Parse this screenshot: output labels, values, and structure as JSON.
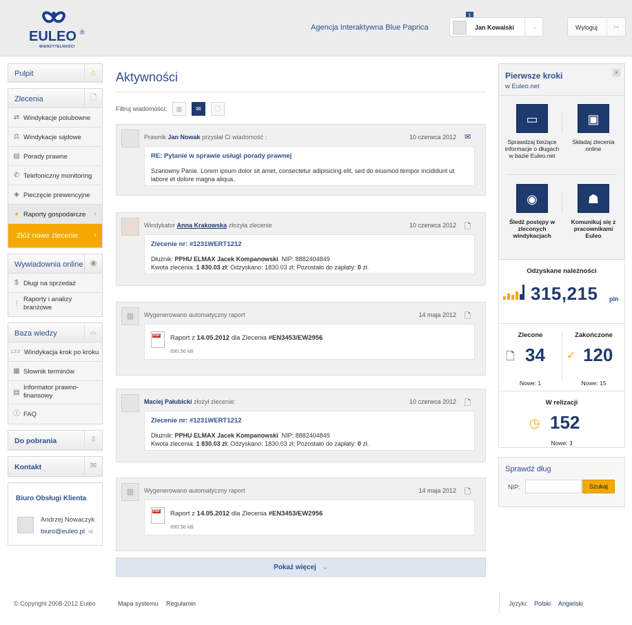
{
  "header": {
    "logo_text": "EULEO",
    "logo_sub": "WIERZYTELNOŚCI",
    "logo_reg": "®",
    "agency": "Agencja Interaktywna Blue Paprica",
    "user_name": "Jan Kowalski",
    "user_badge": "1",
    "logout": "Wyloguj"
  },
  "sidebar": {
    "dashboard": "Pulpit",
    "orders": {
      "title": "Zlecenia",
      "items": [
        {
          "label": "Windykacje polubowne",
          "icon": "handshake-icon"
        },
        {
          "label": "Windykacje sądowe",
          "icon": "gavel-icon"
        },
        {
          "label": "Porady prawne",
          "icon": "book-icon"
        },
        {
          "label": "Telefoniczny monitoring",
          "icon": "phone-icon"
        },
        {
          "label": "Pieczęcie prewencyjne",
          "icon": "stamp-icon"
        },
        {
          "label": "Raporty gospodarcze",
          "icon": "pie-chart-icon"
        }
      ],
      "cta": "Złóż nowe zlecenie"
    },
    "online": {
      "title": "Wywiadownia online",
      "items": [
        {
          "label": "Długi na sprzedaż",
          "icon": "dollar-icon"
        },
        {
          "label": "Raporty i analizy branżowe",
          "icon": "chart-icon"
        }
      ]
    },
    "knowledge": {
      "title": "Baza wiedzy",
      "items": [
        {
          "label": "Windykacja krok po kroku",
          "icon": "1.2.3"
        },
        {
          "label": "Słownik terminów",
          "icon": "dictionary-icon"
        },
        {
          "label": "Informator prawno-finansowy",
          "icon": "document-icon"
        },
        {
          "label": "FAQ",
          "icon": "info-icon"
        }
      ]
    },
    "downloads": "Do pobrania",
    "contact": "Kontakt",
    "office": {
      "title": "Biuro Obsługi Klienta",
      "name": "Andrzej Nowaczyk",
      "email": "biuro@euleo.pl"
    }
  },
  "main": {
    "title": "Aktywności",
    "filter_label": "Filtruj wiadomości:",
    "cards": [
      {
        "pre": "Prawnik",
        "who": "Jan Nowak",
        "post": "przysłał Ci wiadomość :",
        "date": "10 czerwca 2012",
        "subject": "RE: Pytanie w sprawie usługi porady prawnej",
        "text": "Szanowny Panie. Lorem ipsum dolor sit amet, consectetur adipisicing elit, sed do eiusmod tempor incididunt ut labore et dolore magna aliqua."
      },
      {
        "pre": "Windykator",
        "who": "Anna Krakowska",
        "post": "złożyła zlecenie",
        "date": "10 czerwca 2012",
        "subject": "Zlecenie nr: #1231WERT1212",
        "debtor_label": "Dłużnik:",
        "debtor": "PPHU ELMAX Jacek Kompanowski",
        "nip_label": "NIP:",
        "nip": "8882404849",
        "amount_label": "Kwota zlecenia:",
        "amount": "1 830.03 zł",
        "recovered": "; Odzyskano: 1830.03 zł;  Pozostało do zapłaty:",
        "left": "0",
        "left_unit": "zł."
      },
      {
        "head": "Wygenerowano automatyczny raport",
        "date": "14 maja 2012",
        "report_pre": "Raport z",
        "report_date": "14.05.2012",
        "report_mid": "dla Zlecenia",
        "report_id": "#EN3453/EW2956",
        "size": "690.56 kB",
        "pdf": "PDF"
      },
      {
        "who": "Maciej Pałubicki",
        "post": "złożył zlecenie:",
        "date": "10 czerwca 2012",
        "subject": "Zlecenie nr: #1231WERT1212",
        "debtor_label": "Dłużnik:",
        "debtor": "PPHU ELMAX Jacek Kompanowski",
        "nip_label": "NIP:",
        "nip": "8882404849",
        "amount_label": "Kwota zlecenia:",
        "amount": "1 830.03 zł",
        "recovered": "; Odzyskano: 1830.03 zł;  Pozostało do zapłaty:",
        "left": "0",
        "left_unit": "zł."
      },
      {
        "head": "Wygenerowano automatyczny raport",
        "date": "14 maja 2012",
        "report_pre": "Raport z",
        "report_date": "14.05.2012",
        "report_mid": "dla Zlecenia",
        "report_id": "#EN3453/EW2956",
        "size": "690.56 kB",
        "pdf": "PDF"
      }
    ],
    "more": "Pokaż więcej"
  },
  "right": {
    "steps_title": "Pierwsze kroki",
    "steps_sub": "w Euleo.net",
    "close": "×",
    "steps": [
      {
        "label": "Sprawdzaj bieżące informacje o długach w bazie Euleo.net",
        "icon": "inbox-icon"
      },
      {
        "label": "Składaj zlecenia online",
        "icon": "monitor-icon"
      },
      {
        "label": "Śledź postępy w zleconych windykacjach",
        "icon": "eye-icon"
      },
      {
        "label": "Komunikuj się z pracownikami Euleo",
        "icon": "person-icon"
      }
    ],
    "recovered_title": "Odzyskane należności",
    "recovered_value": "315,215",
    "recovered_unit": "pln",
    "ordered_title": "Zlecone",
    "ordered_value": "34",
    "ordered_new": "Nowe: 1",
    "done_title": "Zakończone",
    "done_value": "120",
    "done_new": "Nowe: 15",
    "inprogress_title": "W relizacji",
    "inprogress_value": "152",
    "inprogress_new": "Nowe: 3",
    "check_title": "Sprawdź dług",
    "nip_label": "NIP:",
    "nip_value": "",
    "search": "Szukaj"
  },
  "footer": {
    "copyright": "© Copyright 2008-2012 Euleo",
    "map": "Mapa systemu",
    "rules": "Regulamin",
    "lang_label": "Języki:",
    "polish": "Polski",
    "english": "Angielski"
  },
  "colors": {
    "brand": "#1e3a6e",
    "accent": "#f5a800",
    "link": "#2d4e8f"
  }
}
